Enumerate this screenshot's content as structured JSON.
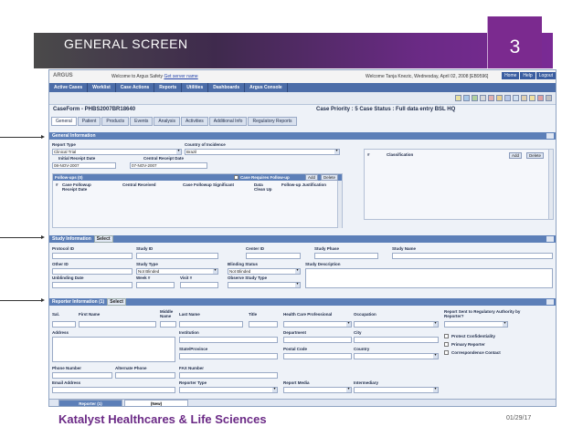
{
  "slide": {
    "title": "GENERAL SCREEN",
    "page_number": "3",
    "footer_company": "Katalyst Healthcares & Life Sciences",
    "footer_date": "01/29/17",
    "colors": {
      "accent": "#7b2a8f",
      "header": "#5c7fb8",
      "menu": "#4c6da8"
    }
  },
  "app": {
    "logo": "ARGUS",
    "welcome_prefix": "Welcome to Argus Safety",
    "welcome_link": "Get server name",
    "user_info": "Welcome Tanja Knezic, Wednesday, April 02, 2008 [EB9596]",
    "top_links": [
      "Home",
      "Help",
      "Logout"
    ],
    "menu": [
      "Active Cases",
      "Worklist",
      "Case Actions",
      "Reports",
      "Utilities",
      "Dashboards",
      "Argus Console"
    ],
    "caseform_title": "CaseForm - PHBS2007BR18640",
    "case_info": "Case Priority : 5  Case Status :  Full data entry BSL HQ",
    "tabs": [
      "General",
      "Patient",
      "Products",
      "Events",
      "Analysis",
      "Activities",
      "Additional Info",
      "Regulatory Reports"
    ],
    "general": {
      "header": "General Information",
      "report_type_label": "Report Type",
      "report_type": "Clinical Trial",
      "country_label": "Country of Incidence",
      "country": "Brazil",
      "initial_receipt_label": "Initial Receipt Date",
      "initial_receipt": "08-NOV-2007",
      "central_receipt_label": "Central Receipt Date",
      "central_receipt": "07-NOV-2007",
      "followups_header": "Follow-ups (0)",
      "case_requires_followup": "Case Requires Follow-up",
      "add": "Add",
      "delete": "Delete",
      "followup_cols": [
        "#",
        "Case Followup Receipt Date",
        "Central Received",
        "Case Followup Significant",
        "Data Clean Up",
        "Follow-up Justification"
      ],
      "classification_cols": [
        "#",
        "Classification"
      ],
      "add2": "Add",
      "delete2": "Delete"
    },
    "study": {
      "header": "Study Information",
      "select": "Select",
      "protocol_id": "Protocol ID",
      "study_id": "Study ID",
      "center_id": "Center ID",
      "study_phase": "Study Phase",
      "study_name": "Study Name",
      "other_id": "Other ID",
      "study_type": "Study Type",
      "study_type_val": "Not Blinded",
      "blinding_status": "Blinding Status",
      "blinding_val": "Not Blinded",
      "study_desc": "Study Description",
      "unblinding_date": "Unblinding Date",
      "week": "Week #",
      "visit": "Visit #",
      "observe_type": "Observe Study Type"
    },
    "reporter": {
      "header": "Reporter Information (1)",
      "select": "Select",
      "sal": "Sal.",
      "first_name": "First Name",
      "middle_name": "Middle Name",
      "last_name": "Last Name",
      "title": "Title",
      "hcp": "Health Care Professional",
      "occupation": "Occupation",
      "report_sent": "Report Sent to Regulatory Authority by Reporter?",
      "address": "Address",
      "institution": "Institution",
      "department": "Department",
      "city": "City",
      "protect": "Protect Confidentiality",
      "state": "State/Province",
      "postal": "Postal Code",
      "country": "Country",
      "primary": "Primary Reporter",
      "correspondence": "Correspondence Contact",
      "phone": "Phone Number",
      "alt_phone": "Alternate Phone",
      "fax": "FAX Number",
      "email": "Email Address",
      "reporter_type": "Reporter Type",
      "report_media": "Report Media",
      "intermediary": "Intermediary",
      "tab1": "Reporter (1)",
      "tab2": "(New)"
    }
  }
}
